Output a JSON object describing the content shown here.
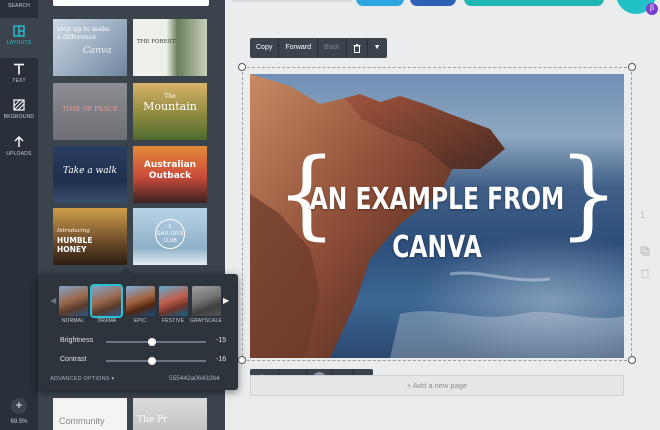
{
  "rail": {
    "items": [
      {
        "label": "SEARCH",
        "icon": "search-icon"
      },
      {
        "label": "LAYOUTS",
        "icon": "layouts-icon"
      },
      {
        "label": "TEXT",
        "icon": "text-icon"
      },
      {
        "label": "BKGROUND",
        "icon": "background-icon"
      },
      {
        "label": "UPLOADS",
        "icon": "uploads-icon"
      }
    ],
    "add_label": "+",
    "zoom": "69.5%"
  },
  "templates": [
    {
      "line1": "step up to make",
      "line2": "a difference",
      "line3": "Canva"
    },
    {
      "line1": "THE FOREST",
      "line2": "",
      "line3": ""
    },
    {
      "line1": "TIME OF PEACE",
      "line2": "",
      "line3": ""
    },
    {
      "line1": "The",
      "line2": "Mountain",
      "line3": ""
    },
    {
      "line1": "Take a walk",
      "line2": "",
      "line3": ""
    },
    {
      "line1": "Australian",
      "line2": "Outback",
      "line3": ""
    },
    {
      "line1": "Introducing",
      "line2": "HUMBLE",
      "line3": "HONEY"
    },
    {
      "line1": "5",
      "line2": "SAILORS",
      "line3": "CLUB"
    },
    {
      "line1": "Community",
      "line2": "",
      "line3": ""
    },
    {
      "line1": "The Pr",
      "line2": "",
      "line3": ""
    }
  ],
  "filters": {
    "options": [
      {
        "label": "NORMAL"
      },
      {
        "label": "DRAMA"
      },
      {
        "label": "EPIC"
      },
      {
        "label": "FESTIVE"
      },
      {
        "label": "GRAYSCALE"
      }
    ],
    "selected": "DRAMA",
    "brightness": {
      "label": "Brightness",
      "value": "-15"
    },
    "contrast": {
      "label": "Contrast",
      "value": "-16"
    },
    "advanced_label": "ADVANCED OPTIONS ▾",
    "code": "555442a06432b4"
  },
  "toolbar_top": {
    "copy": "Copy",
    "forward": "Forward",
    "back": "Back"
  },
  "toolbar_bottom": {
    "filter": "Filter",
    "crop": "Crop"
  },
  "canvas": {
    "line1": "AN EXAMPLE FROM",
    "line2": "CANVA"
  },
  "add_page": "+ Add a new page",
  "page_number": "1",
  "colors": {
    "accent": "#29c2d6",
    "rail": "#293039",
    "panel": "#3b434d"
  }
}
